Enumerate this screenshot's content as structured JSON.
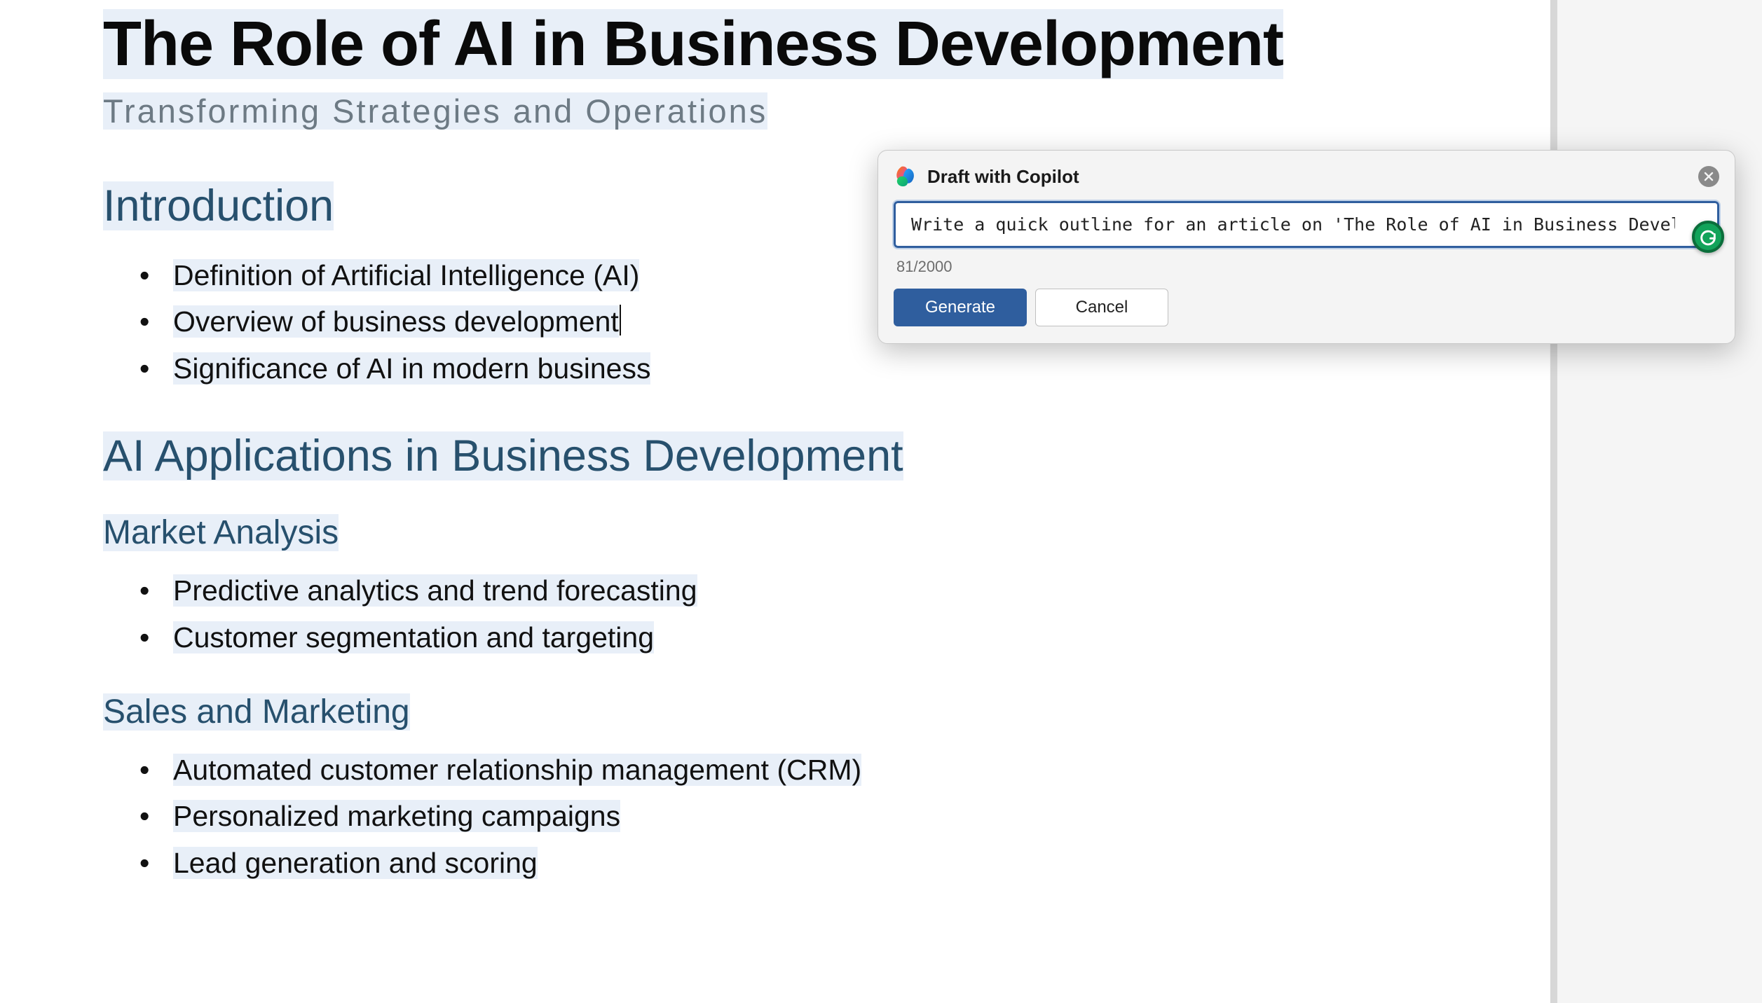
{
  "document": {
    "title": "The Role of AI in Business Development",
    "subtitle": "Transforming Strategies and Operations",
    "sections": [
      {
        "heading": "Introduction",
        "level": 1,
        "items": [
          "Definition of Artificial Intelligence (AI)",
          "Overview of business development",
          "Significance of AI in modern business"
        ]
      },
      {
        "heading": "AI Applications in Business Development",
        "level": 1
      },
      {
        "heading": "Market Analysis",
        "level": 2,
        "items": [
          "Predictive analytics and trend forecasting",
          "Customer segmentation and targeting"
        ]
      },
      {
        "heading": "Sales and Marketing",
        "level": 2,
        "items": [
          "Automated customer relationship management (CRM)",
          "Personalized marketing campaigns",
          "Lead generation and scoring"
        ]
      }
    ]
  },
  "copilot": {
    "title": "Draft with Copilot",
    "prompt": "Write a quick outline for an article on 'The Role of AI in Business Development.'",
    "char_count": "81/2000",
    "generate_label": "Generate",
    "cancel_label": "Cancel"
  }
}
